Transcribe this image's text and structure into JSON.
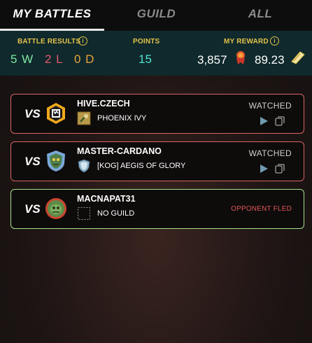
{
  "tabs": {
    "my_battles": "MY BATTLES",
    "guild": "GUILD",
    "all": "ALL"
  },
  "stats": {
    "battle_results_label": "BATTLE RESULTS",
    "wins": "5 W",
    "losses": "2 L",
    "draws": "0 D",
    "points_label": "POINTS",
    "points_value": "15",
    "my_reward_label": "MY REWARD",
    "reward_dec": "3,857",
    "reward_sps": "89.23",
    "info_glyph": "i"
  },
  "battles": [
    {
      "vs": "VS",
      "opponent": "HIVE.CZECH",
      "guild": "PHOENIX IVY",
      "status": "WATCHED",
      "result": "loss"
    },
    {
      "vs": "VS",
      "opponent": "MASTER-CARDANO",
      "guild": "[KOG] AEGIS OF GLORY",
      "status": "WATCHED",
      "result": "loss"
    },
    {
      "vs": "VS",
      "opponent": "MACNAPAT31",
      "guild": "NO GUILD",
      "status": "OPPONENT FLED",
      "result": "win"
    }
  ],
  "colors": {
    "accent_gold": "#e3c34a",
    "win_green": "#7fe8a0",
    "loss_red": "#e45b6e",
    "draw_orange": "#e8a33d",
    "points_teal": "#4fe3d3",
    "loss_border": "#d96565",
    "win_border": "#a5e38c"
  },
  "icons": {
    "battle_results_info": "info-icon",
    "points_info": "info-icon",
    "dec_currency": "dec-token-icon",
    "sps_currency": "sps-token-icon",
    "replay": "play-icon",
    "copy": "copy-icon"
  }
}
